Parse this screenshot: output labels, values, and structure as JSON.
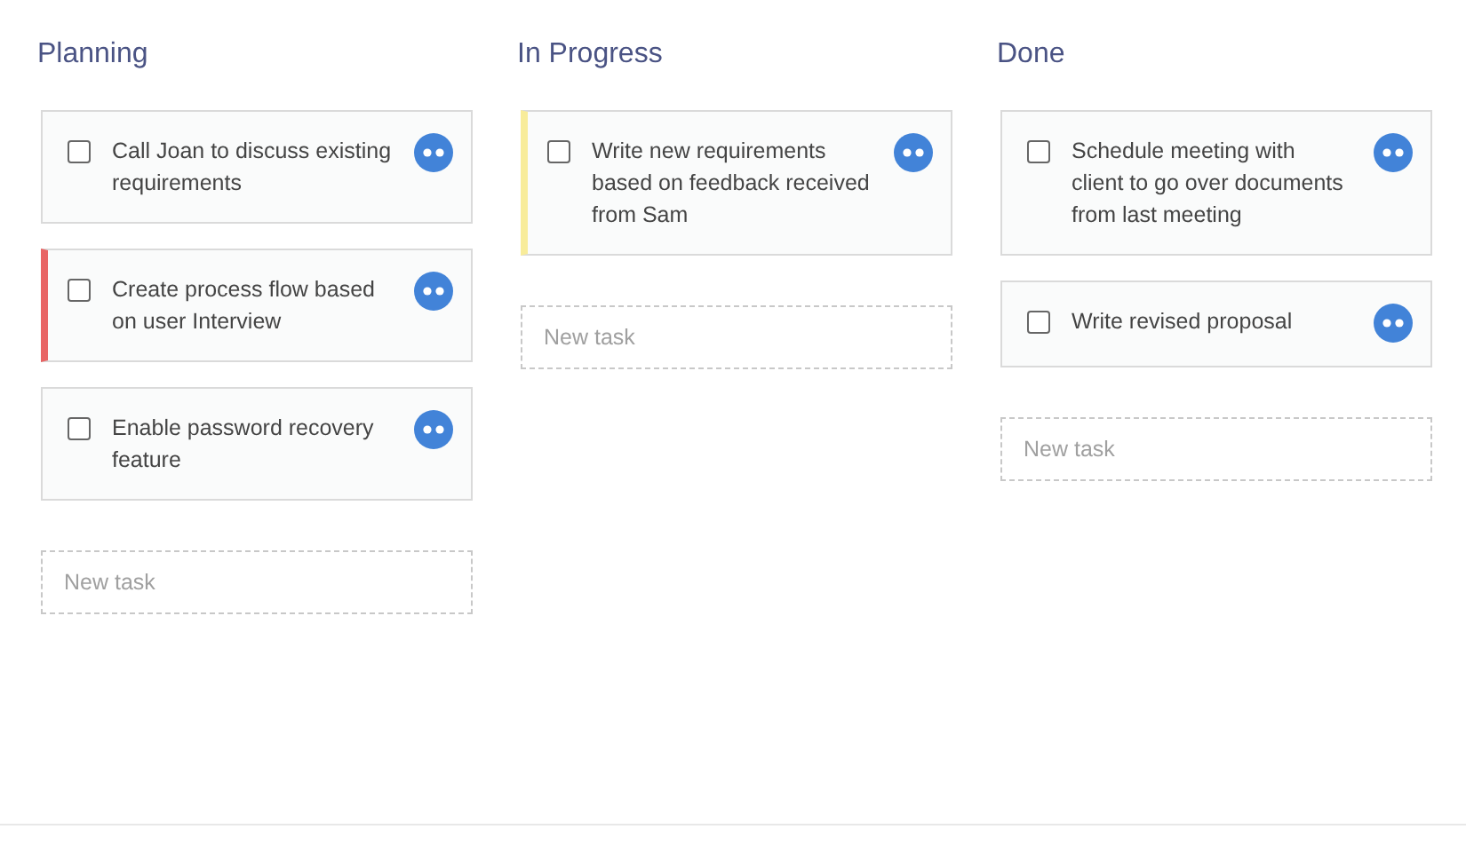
{
  "columns": [
    {
      "title": "Planning",
      "cards": [
        {
          "text": "Call Joan to discuss existing requirements",
          "checked": false
        },
        {
          "text": "Create process flow based on user Interview",
          "checked": false,
          "color": "#e86464"
        },
        {
          "text": "Enable password recovery feature",
          "checked": false
        }
      ],
      "new_task": {
        "placeholder": "New task"
      }
    },
    {
      "title": "In Progress",
      "cards": [
        {
          "text": "Write new requirements based on feedback received from Sam",
          "checked": false,
          "color": "#f8ec9a"
        }
      ],
      "new_task": {
        "placeholder": "New task"
      }
    },
    {
      "title": "Done",
      "cards": [
        {
          "text": "Schedule meeting with client to go over documents from last meeting",
          "checked": false
        },
        {
          "text": "Write revised proposal",
          "checked": false
        }
      ],
      "new_task": {
        "placeholder": "New task"
      }
    }
  ]
}
